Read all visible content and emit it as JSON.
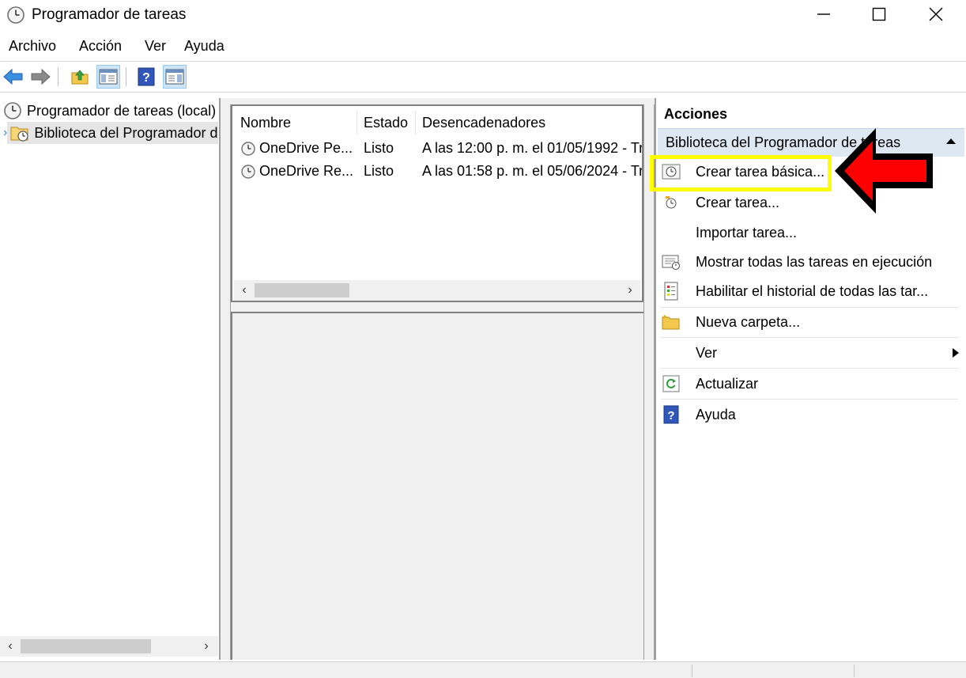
{
  "window": {
    "title": "Programador de tareas"
  },
  "menu": [
    "Archivo",
    "Acción",
    "Ver",
    "Ayuda"
  ],
  "toolbar_icons": [
    "back-arrow-icon",
    "forward-arrow-icon",
    "folder-up-icon",
    "show-hide-console-tree-icon",
    "help-icon",
    "show-hide-action-pane-icon"
  ],
  "tree": {
    "root": "Programador de tareas (local)",
    "child": "Biblioteca del Programador de tareas"
  },
  "task_table": {
    "columns": [
      "Nombre",
      "Estado",
      "Desencadenadores"
    ],
    "rows": [
      {
        "name": "OneDrive Pe...",
        "status": "Listo",
        "trigger": "A las 12:00 p. m. el 01/05/1992 - Tr"
      },
      {
        "name": "OneDrive Re...",
        "status": "Listo",
        "trigger": "A las 01:58 p. m. el 05/06/2024 - Tr"
      }
    ]
  },
  "actions": {
    "title": "Acciones",
    "group": "Biblioteca del Programador de tareas",
    "items": [
      {
        "label": "Crear tarea básica...",
        "icon": "create-basic-task-icon"
      },
      {
        "label": "Crear tarea...",
        "icon": "create-task-icon"
      },
      {
        "label": "Importar tarea...",
        "icon": ""
      },
      {
        "label": "Mostrar todas las tareas en ejecución",
        "icon": "running-tasks-icon"
      },
      {
        "label": "Habilitar el historial de todas las tar...",
        "icon": "history-icon"
      },
      {
        "label": "Nueva carpeta...",
        "icon": "new-folder-icon"
      },
      {
        "label": "Ver",
        "icon": ""
      },
      {
        "label": "Actualizar",
        "icon": "refresh-icon"
      },
      {
        "label": "Ayuda",
        "icon": "help-icon"
      }
    ]
  },
  "annotation": {
    "highlight_color": "#ffff00",
    "arrow_color": "#ff0000"
  },
  "colors": {
    "selection": "#cce4f7",
    "group_header": "#dde8f3",
    "tree_selected": "#e5e5e5",
    "chevron": "#3a8fd6"
  }
}
